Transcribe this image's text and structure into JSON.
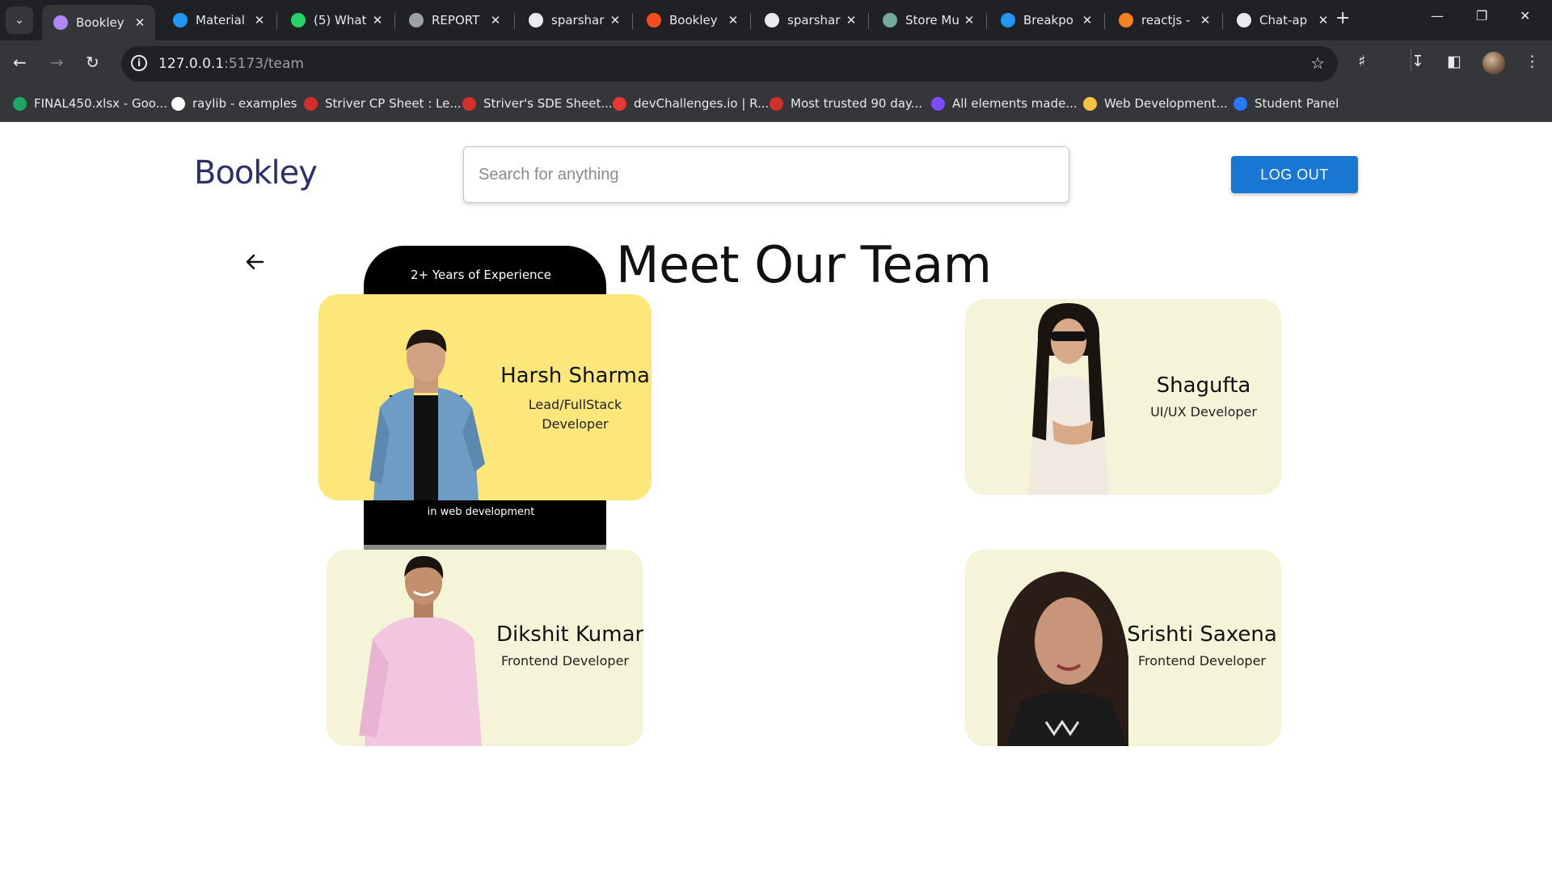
{
  "browser": {
    "tabs": [
      {
        "title": "Bookley",
        "icon": "vite-icon",
        "color": "#b085f5",
        "active": true
      },
      {
        "title": "Material",
        "icon": "mui-icon",
        "color": "#2196f3"
      },
      {
        "title": "(5) What",
        "icon": "whatsapp-icon",
        "color": "#25d366"
      },
      {
        "title": "REPORT",
        "icon": "globe-icon",
        "color": "#9aa0a6"
      },
      {
        "title": "sparshar",
        "icon": "github-icon",
        "color": "#e8eaed"
      },
      {
        "title": "Bookley",
        "icon": "figma-icon",
        "color": "#f24e1e"
      },
      {
        "title": "sparshar",
        "icon": "github-icon",
        "color": "#e8eaed"
      },
      {
        "title": "Store Mu",
        "icon": "chatgpt-icon",
        "color": "#74aa9c"
      },
      {
        "title": "Breakpo",
        "icon": "mui-icon",
        "color": "#2196f3"
      },
      {
        "title": "reactjs -",
        "icon": "stackoverflow-icon",
        "color": "#f48024"
      },
      {
        "title": "Chat-ap",
        "icon": "github-icon",
        "color": "#e8eaed"
      }
    ],
    "url_host": "127.0.0.1",
    "url_rest": ":5173/team",
    "bookmarks": [
      {
        "label": "FINAL450.xlsx - Goo...",
        "icon": "drive-icon",
        "color": "#1fa463"
      },
      {
        "label": "raylib - examples",
        "icon": "raylib-icon",
        "color": "#ffffff"
      },
      {
        "label": "Striver CP Sheet : Le...",
        "icon": "tuf-icon",
        "color": "#d32f2f"
      },
      {
        "label": "Striver's SDE Sheet...",
        "icon": "tuf-icon",
        "color": "#d32f2f"
      },
      {
        "label": "devChallenges.io | R...",
        "icon": "code-icon",
        "color": "#e53935"
      },
      {
        "label": "Most trusted 90 day...",
        "icon": "tuf-icon",
        "color": "#d32f2f"
      },
      {
        "label": "All elements made...",
        "icon": "uiverse-icon",
        "color": "#7c4dff"
      },
      {
        "label": "Web Development...",
        "icon": "coin-icon",
        "color": "#f6c343"
      },
      {
        "label": "Student Panel",
        "icon": "shield-icon",
        "color": "#2979ff"
      }
    ]
  },
  "header": {
    "brand": "Bookley",
    "search_placeholder": "Search for anything",
    "logout_label": "LOG OUT"
  },
  "page": {
    "heading": "Meet Our Team",
    "experience_top": "2+ Years of Experience",
    "experience_bottom": "in web development"
  },
  "team": [
    {
      "name": "Harsh Sharma",
      "role": "Lead/FullStack Developer"
    },
    {
      "name": "Shagufta",
      "role": "UI/UX Developer"
    },
    {
      "name": "Dikshit Kumar",
      "role": "Frontend Developer"
    },
    {
      "name": "Srishti Saxena",
      "role": "Frontend Developer"
    }
  ]
}
